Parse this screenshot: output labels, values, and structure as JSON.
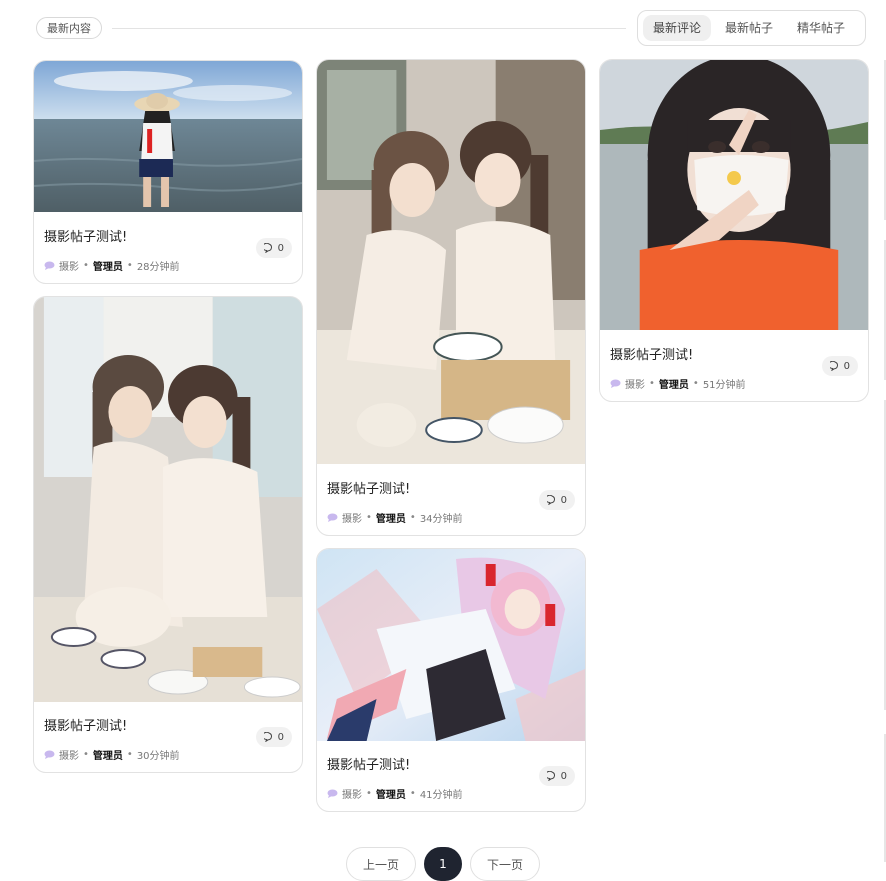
{
  "header": {
    "section_label": "最新内容",
    "tabs": [
      {
        "label": "最新评论",
        "active": true
      },
      {
        "label": "最新帖子",
        "active": false
      },
      {
        "label": "精华帖子",
        "active": false
      }
    ]
  },
  "posts": [
    {
      "title": "摄影帖子测试!",
      "category": "摄影",
      "author": "管理员",
      "time": "28分钟前",
      "comments": "0",
      "image": "photo-beach"
    },
    {
      "title": "摄影帖子测试!",
      "category": "摄影",
      "author": "管理员",
      "time": "30分钟前",
      "comments": "0",
      "image": "photo-kitchen-hug"
    },
    {
      "title": "摄影帖子测试!",
      "category": "摄影",
      "author": "管理员",
      "time": "34分钟前",
      "comments": "0",
      "image": "photo-kitchen-dumplings"
    },
    {
      "title": "摄影帖子测试!",
      "category": "摄影",
      "author": "管理员",
      "time": "41分钟前",
      "comments": "0",
      "image": "illustration-anime"
    },
    {
      "title": "摄影帖子测试!",
      "category": "摄影",
      "author": "管理员",
      "time": "51分钟前",
      "comments": "0",
      "image": "photo-selfie-lake"
    }
  ],
  "pagination": {
    "prev": "上一页",
    "current": "1",
    "next": "下一页"
  },
  "icons": {
    "comment": "comment-bubble-icon",
    "category": "chat-bubble-icon"
  },
  "colors": {
    "accent": "#1f2430",
    "category_icon": "#b9a7e6"
  }
}
